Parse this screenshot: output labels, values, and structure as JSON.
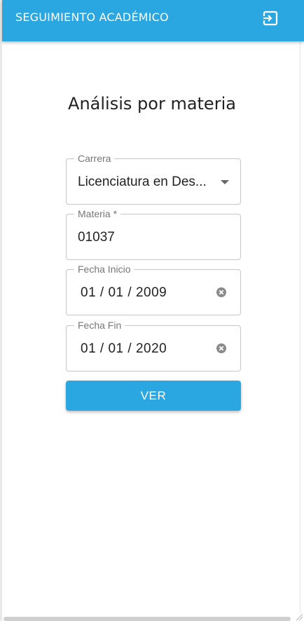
{
  "appbar": {
    "title": "SEGUIMIENTO ACADÉMICO",
    "exit_icon": "exit-to-app-icon"
  },
  "page": {
    "heading": "Análisis por materia"
  },
  "form": {
    "carrera": {
      "label": "Carrera",
      "value": "Licenciatura en Des..."
    },
    "materia": {
      "label": "Materia *",
      "value": "01037"
    },
    "fecha_inicio": {
      "label": "Fecha Inicio",
      "value": "01 / 01 / 2009"
    },
    "fecha_fin": {
      "label": "Fecha Fin",
      "value": "01 / 01 / 2020"
    },
    "submit_label": "VER"
  },
  "colors": {
    "primary": "#2aa7e1",
    "border": "#c6c6c6",
    "label": "#777777",
    "text": "#222222"
  }
}
